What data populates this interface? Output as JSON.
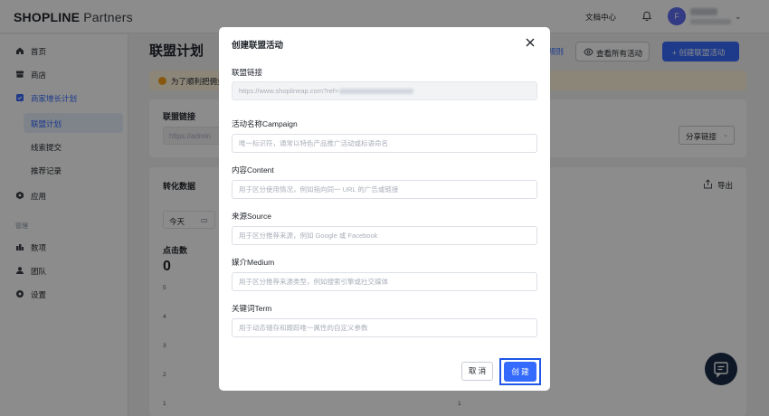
{
  "header": {
    "logo_bold": "SHOPLINE",
    "logo_light": "Partners",
    "docs": "文档中心",
    "avatar_initial": "F"
  },
  "sidebar": {
    "items": [
      {
        "label": "首页",
        "icon": "home-icon"
      },
      {
        "label": "商店",
        "icon": "store-icon"
      },
      {
        "label": "商家增长计划",
        "icon": "growth-icon"
      }
    ],
    "subitems": [
      {
        "label": "联盟计划"
      },
      {
        "label": "线索提交"
      },
      {
        "label": "推荐记录"
      }
    ],
    "apps": {
      "label": "应用",
      "icon": "app-icon"
    },
    "section_manage": "管理",
    "manage_items": [
      {
        "label": "数项",
        "icon": "data-icon"
      },
      {
        "label": "团队",
        "icon": "team-icon"
      },
      {
        "label": "设置",
        "icon": "settings-icon"
      }
    ]
  },
  "main": {
    "title": "联盟计划",
    "rules_link": "规则",
    "view_all": "查看所有活动",
    "create_button": "+ 创建联盟活动",
    "notice": "为了顺利把佣金",
    "affiliate_card": {
      "title": "联盟链接",
      "input_value": "https://admin",
      "share_button": "分享链接"
    },
    "conversion_card": {
      "title": "转化数据",
      "export": "导出",
      "date_value": "今天",
      "clicks_label": "点击数",
      "clicks_value": "0",
      "y_ticks": [
        "5",
        "4",
        "3",
        "2",
        "1"
      ],
      "y_ticks_right": [
        "1"
      ]
    }
  },
  "modal": {
    "title": "创建联盟活动",
    "fields": [
      {
        "label": "联盟链接",
        "placeholder": "https://www.shoplineap.com?ref=",
        "disabled": true
      },
      {
        "label": "活动名称Campaign",
        "placeholder": "唯一标识符，通常以特色产品推广活动或标语命名"
      },
      {
        "label": "内容Content",
        "placeholder": "用于区分使用情况，例如指向同一 URL 的广告或链接"
      },
      {
        "label": "来源Source",
        "placeholder": "用于区分推荐来源，例如 Google 或 Facebook"
      },
      {
        "label": "媒介Medium",
        "placeholder": "用于区分推荐来源类型，例如搜索引擎或社交媒体"
      },
      {
        "label": "关键词Term",
        "placeholder": "用于动态储存和跟踪唯一属性的自定义参数"
      }
    ],
    "cancel": "取 消",
    "create": "创 建"
  },
  "colors": {
    "primary": "#356bfd",
    "highlight_border": "#1f56e6",
    "notice_bg": "#fff4dc",
    "chat_fab": "#1a2b46"
  }
}
